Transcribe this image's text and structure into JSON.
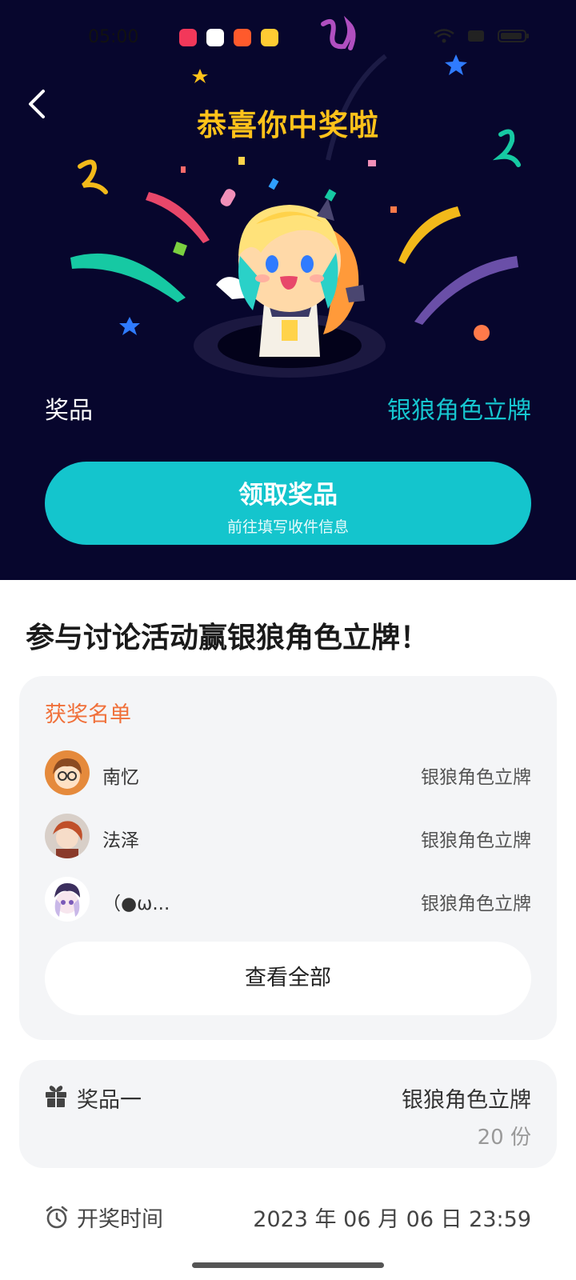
{
  "status_bar": {
    "time": "05:00",
    "app_icons": [
      {
        "name": "video-app-icon",
        "color": "#f2385a"
      },
      {
        "name": "photo-app-icon",
        "color": "#ffffff"
      },
      {
        "name": "social-app-icon",
        "color": "#ff5a2c"
      },
      {
        "name": "book-app-icon",
        "color": "#ffcc33"
      }
    ]
  },
  "hero": {
    "title": "恭喜你中奖啦",
    "prize_label": "奖品",
    "prize_value": "银狼角色立牌",
    "claim_button": {
      "label": "领取奖品",
      "sublabel": "前往填写收件信息"
    }
  },
  "activity": {
    "title": "参与讨论活动赢银狼角色立牌！"
  },
  "winners": {
    "heading": "获奖名单",
    "rows": [
      {
        "name": "南忆",
        "prize": "银狼角色立牌"
      },
      {
        "name": "法泽",
        "prize": "银狼角色立牌"
      },
      {
        "name": "（●ω...",
        "prize": "银狼角色立牌"
      }
    ],
    "view_all": "查看全部"
  },
  "prize_card": {
    "label": "奖品一",
    "name": "银狼角色立牌",
    "quantity": "20 份"
  },
  "draw": {
    "label": "开奖时间",
    "value": "2023 年 06 月 06 日 23:59"
  },
  "colors": {
    "hero_bg": "#07062d",
    "title": "#ffc21a",
    "accent": "#14c5cd",
    "winners_heading": "#f0703a"
  }
}
